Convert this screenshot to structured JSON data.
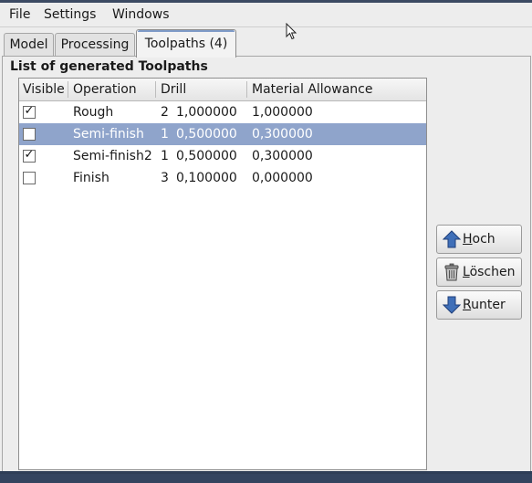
{
  "menubar": {
    "items": [
      "File",
      "Settings",
      "Windows"
    ]
  },
  "tabs": [
    {
      "label": "Model",
      "active": false
    },
    {
      "label": "Processing",
      "active": false
    },
    {
      "label": "Toolpaths (4)",
      "active": true
    }
  ],
  "section": {
    "title": "List of generated Toolpaths"
  },
  "table": {
    "columns": [
      "Visible",
      "Operation",
      "Drill",
      "Material Allowance"
    ],
    "rows": [
      {
        "visible": true,
        "operation": "Rough",
        "drill_num": "2",
        "drill_val": "1,000000",
        "allowance": "1,000000",
        "selected": false
      },
      {
        "visible": false,
        "operation": "Semi-finish",
        "drill_num": "1",
        "drill_val": "0,500000",
        "allowance": "0,300000",
        "selected": true
      },
      {
        "visible": true,
        "operation": "Semi-finish2",
        "drill_num": "1",
        "drill_val": "0,500000",
        "allowance": "0,300000",
        "selected": false
      },
      {
        "visible": false,
        "operation": "Finish",
        "drill_num": "3",
        "drill_val": "0,100000",
        "allowance": "0,000000",
        "selected": false
      }
    ]
  },
  "buttons": {
    "up": {
      "mnemonic": "H",
      "rest": "och",
      "icon": "arrow-up-icon"
    },
    "delete": {
      "mnemonic": "L",
      "rest": "öschen",
      "icon": "trash-icon"
    },
    "down": {
      "mnemonic": "R",
      "rest": "unter",
      "icon": "arrow-down-icon"
    }
  },
  "colors": {
    "selection": "#8fa4cb",
    "arrow": "#3f6fb8"
  }
}
